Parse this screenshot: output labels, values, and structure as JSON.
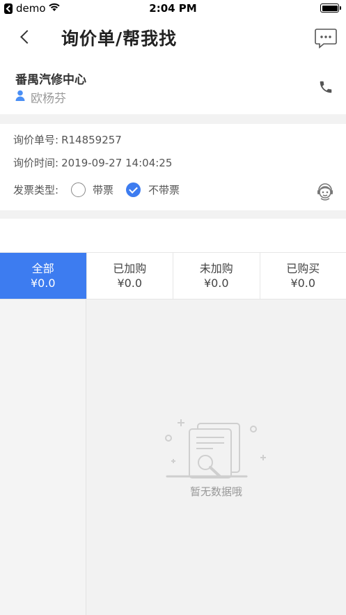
{
  "status_bar": {
    "carrier": "demo",
    "time": "2:04 PM"
  },
  "nav": {
    "title": "询价单/帮我找"
  },
  "shop": {
    "name": "番禺汽修中心",
    "contact": "欧杨芬"
  },
  "inquiry": {
    "number_label": "询价单号:",
    "number": "R14859257",
    "time_label": "询价时间:",
    "time": "2019-09-27 14:04:25",
    "invoice_label": "发票类型:",
    "invoice_options": [
      {
        "label": "带票",
        "checked": false
      },
      {
        "label": "不带票",
        "checked": true
      }
    ]
  },
  "tabs": [
    {
      "label": "全部",
      "amount": "¥0.0",
      "active": true
    },
    {
      "label": "已加购",
      "amount": "¥0.0",
      "active": false
    },
    {
      "label": "未加购",
      "amount": "¥0.0",
      "active": false
    },
    {
      "label": "已购买",
      "amount": "¥0.0",
      "active": false
    }
  ],
  "empty_state": {
    "text": "暂无数据哦"
  },
  "colors": {
    "accent": "#3d7cf0",
    "background": "#f2f2f2"
  }
}
